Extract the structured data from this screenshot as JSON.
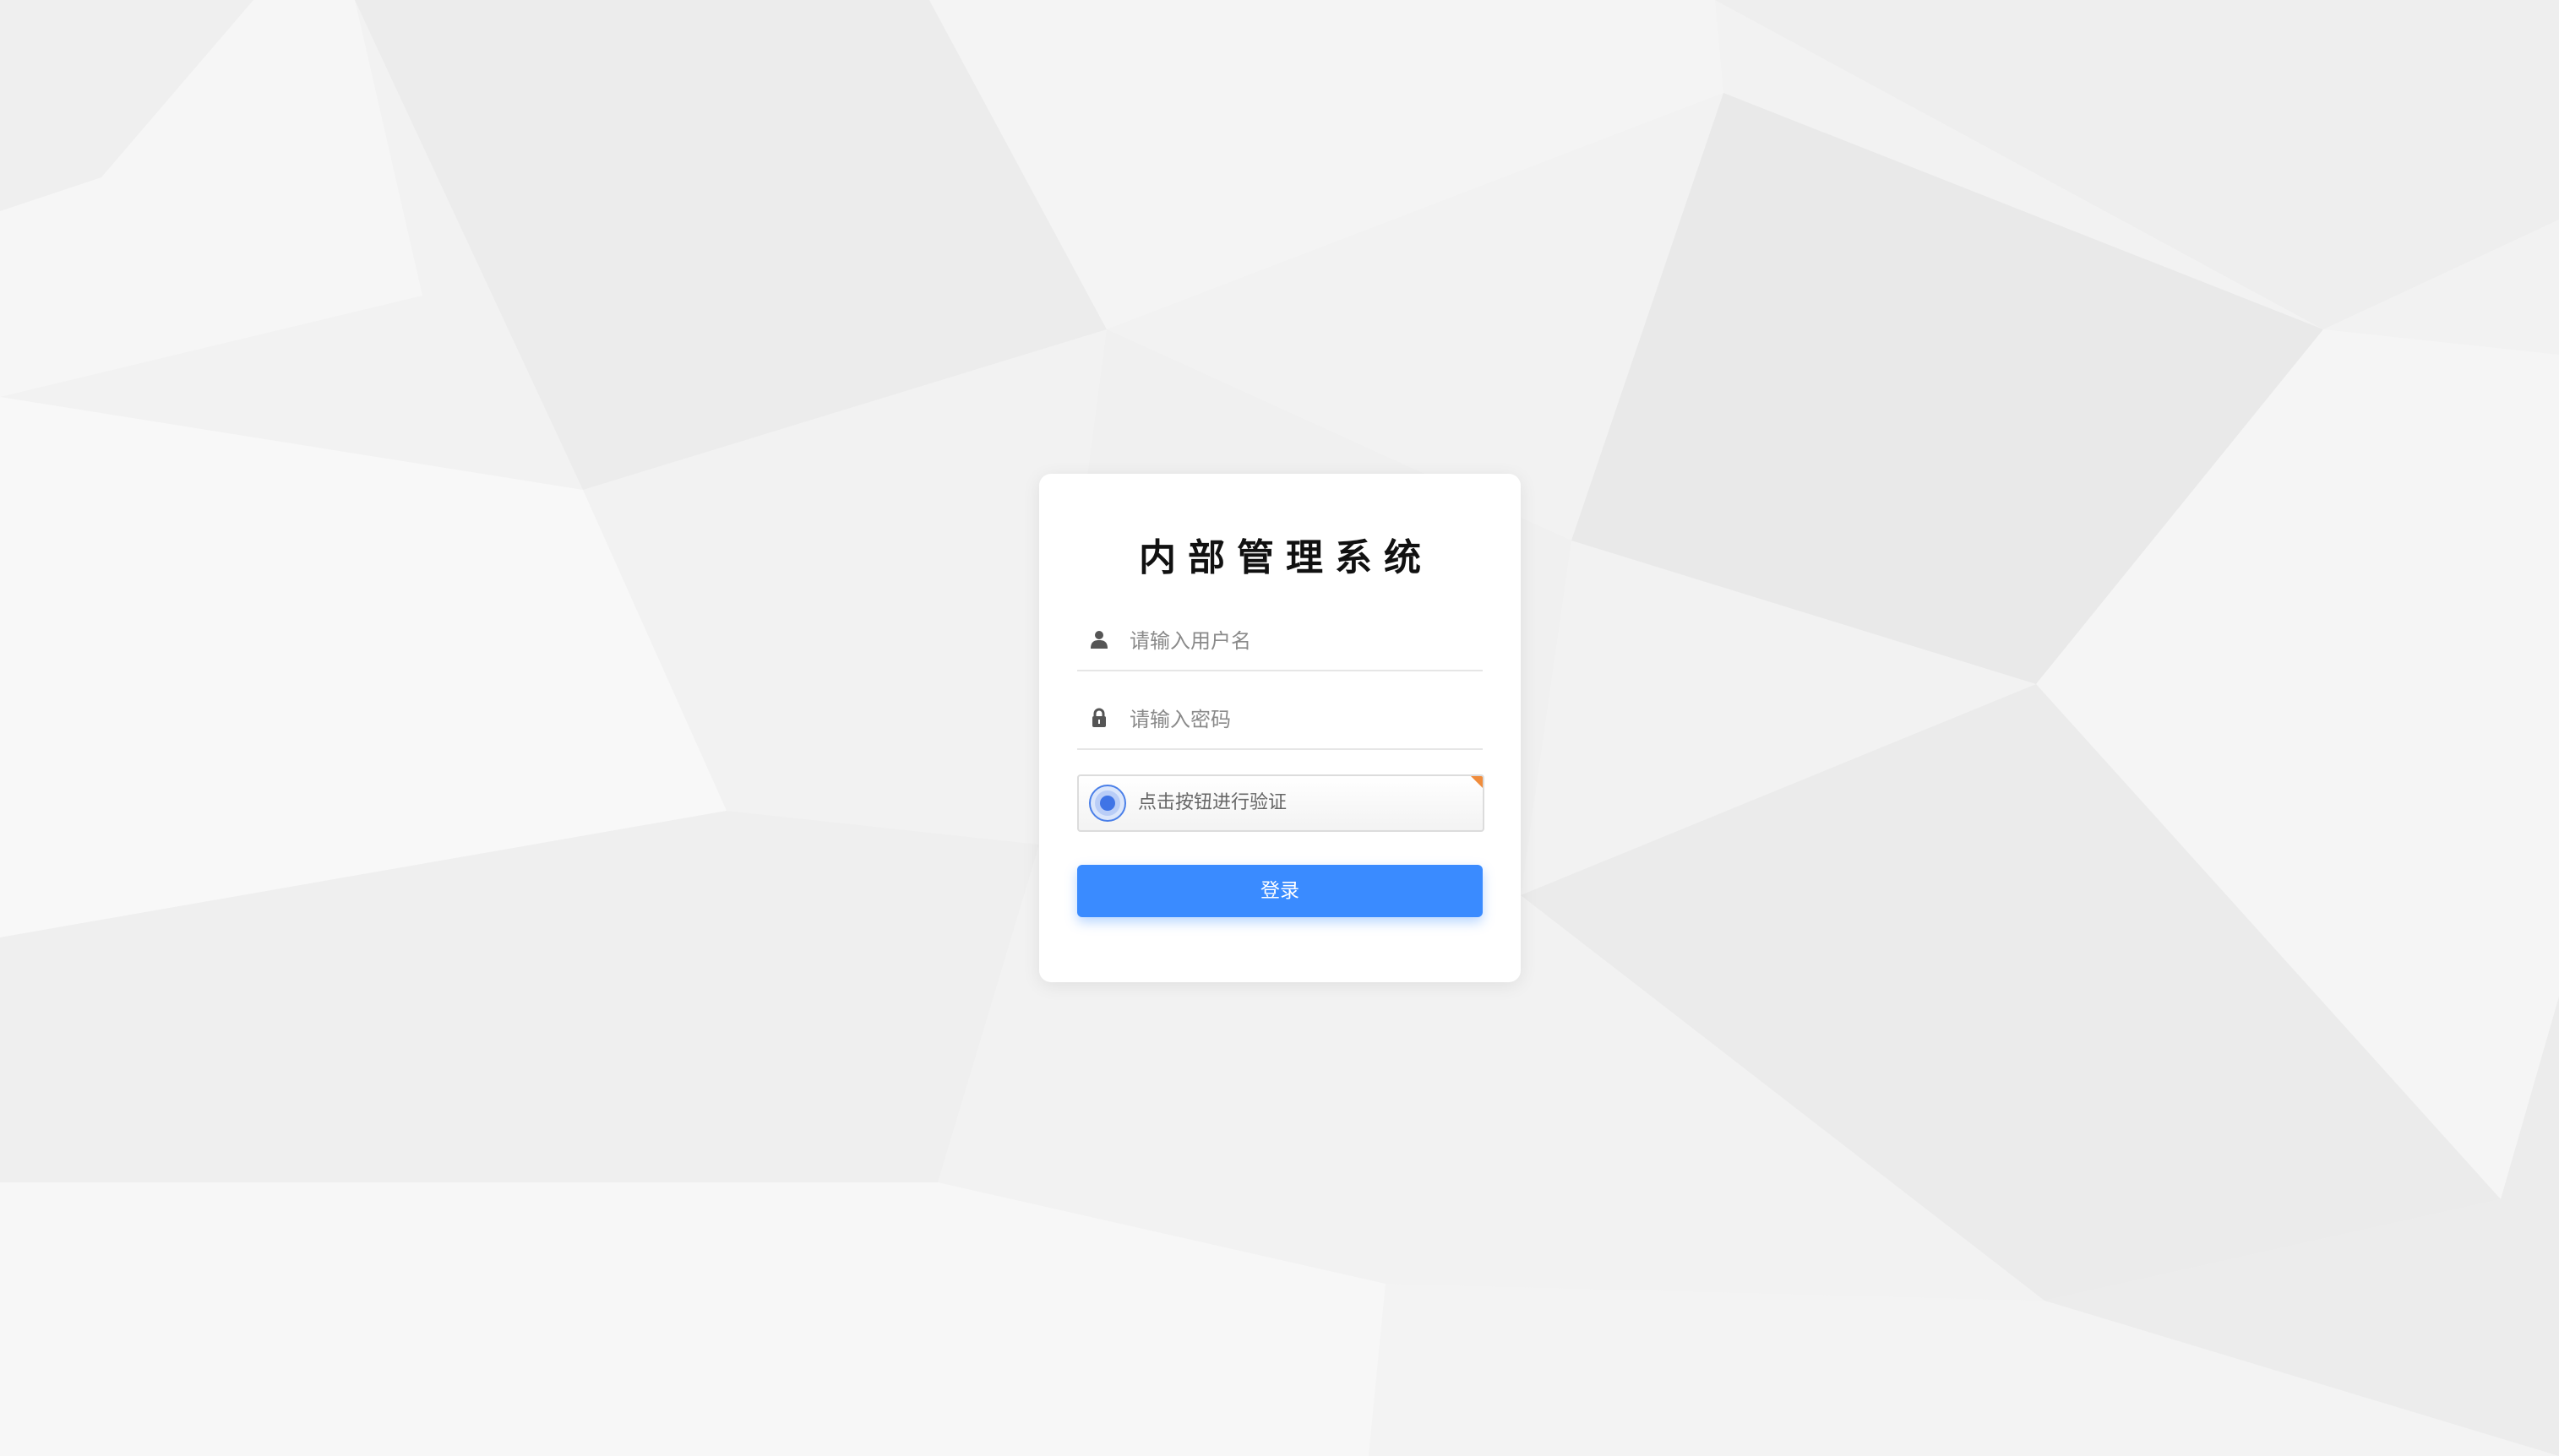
{
  "login": {
    "title": "内部管理系统",
    "username": {
      "placeholder": "请输入用户名",
      "icon": "user-icon"
    },
    "password": {
      "placeholder": "请输入密码",
      "icon": "lock-icon"
    },
    "captcha": {
      "label": "点击按钮进行验证",
      "icon": "verify-circle-icon"
    },
    "submit_label": "登录"
  },
  "colors": {
    "background": "#f1f1f1",
    "card": "#ffffff",
    "primary": "#3a8bff",
    "captcha_icon": "#4a7fe8",
    "captcha_corner": "#f08c3c",
    "title": "#111111",
    "placeholder": "#8a8a8a"
  }
}
